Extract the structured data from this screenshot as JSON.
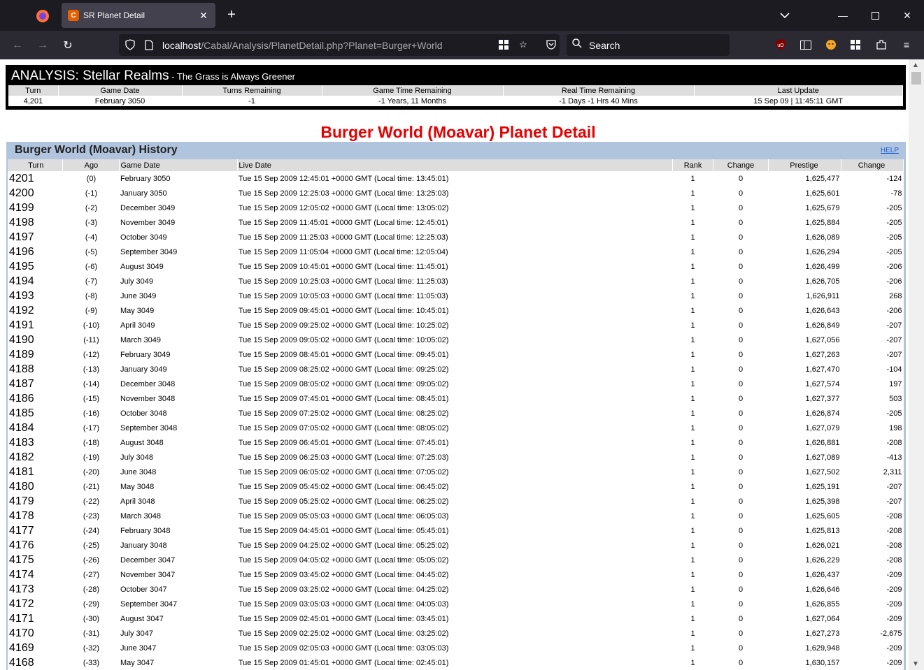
{
  "browser": {
    "tab_title": "SR Planet Detail",
    "url_host": "localhost",
    "url_path": "/Cabal/Analysis/PlanetDetail.php?Planet=Burger+World",
    "search_placeholder": "Search"
  },
  "analysis": {
    "title": "ANALYSIS: Stellar Realms",
    "subtitle": " - The Grass is Always Greener",
    "headers": [
      "Turn",
      "Game Date",
      "Turns Remaining",
      "Game Time Remaining",
      "Real Time Remaining",
      "Last Update"
    ],
    "values": [
      "4,201",
      "February 3050",
      "-1",
      "-1 Years, 11 Months",
      "-1 Days -1 Hrs 40 Mins",
      "15 Sep 09 | 11:45:11 GMT"
    ]
  },
  "page_heading": "Burger World (Moavar) Planet Detail",
  "history": {
    "title": "Burger World (Moavar) History",
    "help_label": "HELP",
    "columns": [
      "Turn",
      "Ago",
      "Game Date",
      "Live Date",
      "Rank",
      "Change",
      "Prestige",
      "Change"
    ],
    "rows": [
      [
        "4201",
        "(0)",
        "February 3050",
        "Tue 15 Sep 2009 12:45:01 +0000 GMT (Local time: 13:45:01)",
        "1",
        "0",
        "1,625,477",
        "-124"
      ],
      [
        "4200",
        "(-1)",
        "January 3050",
        "Tue 15 Sep 2009 12:25:03 +0000 GMT (Local time: 13:25:03)",
        "1",
        "0",
        "1,625,601",
        "-78"
      ],
      [
        "4199",
        "(-2)",
        "December 3049",
        "Tue 15 Sep 2009 12:05:02 +0000 GMT (Local time: 13:05:02)",
        "1",
        "0",
        "1,625,679",
        "-205"
      ],
      [
        "4198",
        "(-3)",
        "November 3049",
        "Tue 15 Sep 2009 11:45:01 +0000 GMT (Local time: 12:45:01)",
        "1",
        "0",
        "1,625,884",
        "-205"
      ],
      [
        "4197",
        "(-4)",
        "October 3049",
        "Tue 15 Sep 2009 11:25:03 +0000 GMT (Local time: 12:25:03)",
        "1",
        "0",
        "1,626,089",
        "-205"
      ],
      [
        "4196",
        "(-5)",
        "September 3049",
        "Tue 15 Sep 2009 11:05:04 +0000 GMT (Local time: 12:05:04)",
        "1",
        "0",
        "1,626,294",
        "-205"
      ],
      [
        "4195",
        "(-6)",
        "August 3049",
        "Tue 15 Sep 2009 10:45:01 +0000 GMT (Local time: 11:45:01)",
        "1",
        "0",
        "1,626,499",
        "-206"
      ],
      [
        "4194",
        "(-7)",
        "July 3049",
        "Tue 15 Sep 2009 10:25:03 +0000 GMT (Local time: 11:25:03)",
        "1",
        "0",
        "1,626,705",
        "-206"
      ],
      [
        "4193",
        "(-8)",
        "June 3049",
        "Tue 15 Sep 2009 10:05:03 +0000 GMT (Local time: 11:05:03)",
        "1",
        "0",
        "1,626,911",
        "268"
      ],
      [
        "4192",
        "(-9)",
        "May 3049",
        "Tue 15 Sep 2009 09:45:01 +0000 GMT (Local time: 10:45:01)",
        "1",
        "0",
        "1,626,643",
        "-206"
      ],
      [
        "4191",
        "(-10)",
        "April 3049",
        "Tue 15 Sep 2009 09:25:02 +0000 GMT (Local time: 10:25:02)",
        "1",
        "0",
        "1,626,849",
        "-207"
      ],
      [
        "4190",
        "(-11)",
        "March 3049",
        "Tue 15 Sep 2009 09:05:02 +0000 GMT (Local time: 10:05:02)",
        "1",
        "0",
        "1,627,056",
        "-207"
      ],
      [
        "4189",
        "(-12)",
        "February 3049",
        "Tue 15 Sep 2009 08:45:01 +0000 GMT (Local time: 09:45:01)",
        "1",
        "0",
        "1,627,263",
        "-207"
      ],
      [
        "4188",
        "(-13)",
        "January 3049",
        "Tue 15 Sep 2009 08:25:02 +0000 GMT (Local time: 09:25:02)",
        "1",
        "0",
        "1,627,470",
        "-104"
      ],
      [
        "4187",
        "(-14)",
        "December 3048",
        "Tue 15 Sep 2009 08:05:02 +0000 GMT (Local time: 09:05:02)",
        "1",
        "0",
        "1,627,574",
        "197"
      ],
      [
        "4186",
        "(-15)",
        "November 3048",
        "Tue 15 Sep 2009 07:45:01 +0000 GMT (Local time: 08:45:01)",
        "1",
        "0",
        "1,627,377",
        "503"
      ],
      [
        "4185",
        "(-16)",
        "October 3048",
        "Tue 15 Sep 2009 07:25:02 +0000 GMT (Local time: 08:25:02)",
        "1",
        "0",
        "1,626,874",
        "-205"
      ],
      [
        "4184",
        "(-17)",
        "September 3048",
        "Tue 15 Sep 2009 07:05:02 +0000 GMT (Local time: 08:05:02)",
        "1",
        "0",
        "1,627,079",
        "198"
      ],
      [
        "4183",
        "(-18)",
        "August 3048",
        "Tue 15 Sep 2009 06:45:01 +0000 GMT (Local time: 07:45:01)",
        "1",
        "0",
        "1,626,881",
        "-208"
      ],
      [
        "4182",
        "(-19)",
        "July 3048",
        "Tue 15 Sep 2009 06:25:03 +0000 GMT (Local time: 07:25:03)",
        "1",
        "0",
        "1,627,089",
        "-413"
      ],
      [
        "4181",
        "(-20)",
        "June 3048",
        "Tue 15 Sep 2009 06:05:02 +0000 GMT (Local time: 07:05:02)",
        "1",
        "0",
        "1,627,502",
        "2,311"
      ],
      [
        "4180",
        "(-21)",
        "May 3048",
        "Tue 15 Sep 2009 05:45:02 +0000 GMT (Local time: 06:45:02)",
        "1",
        "0",
        "1,625,191",
        "-207"
      ],
      [
        "4179",
        "(-22)",
        "April 3048",
        "Tue 15 Sep 2009 05:25:02 +0000 GMT (Local time: 06:25:02)",
        "1",
        "0",
        "1,625,398",
        "-207"
      ],
      [
        "4178",
        "(-23)",
        "March 3048",
        "Tue 15 Sep 2009 05:05:03 +0000 GMT (Local time: 06:05:03)",
        "1",
        "0",
        "1,625,605",
        "-208"
      ],
      [
        "4177",
        "(-24)",
        "February 3048",
        "Tue 15 Sep 2009 04:45:01 +0000 GMT (Local time: 05:45:01)",
        "1",
        "0",
        "1,625,813",
        "-208"
      ],
      [
        "4176",
        "(-25)",
        "January 3048",
        "Tue 15 Sep 2009 04:25:02 +0000 GMT (Local time: 05:25:02)",
        "1",
        "0",
        "1,626,021",
        "-208"
      ],
      [
        "4175",
        "(-26)",
        "December 3047",
        "Tue 15 Sep 2009 04:05:02 +0000 GMT (Local time: 05:05:02)",
        "1",
        "0",
        "1,626,229",
        "-208"
      ],
      [
        "4174",
        "(-27)",
        "November 3047",
        "Tue 15 Sep 2009 03:45:02 +0000 GMT (Local time: 04:45:02)",
        "1",
        "0",
        "1,626,437",
        "-209"
      ],
      [
        "4173",
        "(-28)",
        "October 3047",
        "Tue 15 Sep 2009 03:25:02 +0000 GMT (Local time: 04:25:02)",
        "1",
        "0",
        "1,626,646",
        "-209"
      ],
      [
        "4172",
        "(-29)",
        "September 3047",
        "Tue 15 Sep 2009 03:05:03 +0000 GMT (Local time: 04:05:03)",
        "1",
        "0",
        "1,626,855",
        "-209"
      ],
      [
        "4171",
        "(-30)",
        "August 3047",
        "Tue 15 Sep 2009 02:45:01 +0000 GMT (Local time: 03:45:01)",
        "1",
        "0",
        "1,627,064",
        "-209"
      ],
      [
        "4170",
        "(-31)",
        "July 3047",
        "Tue 15 Sep 2009 02:25:02 +0000 GMT (Local time: 03:25:02)",
        "1",
        "0",
        "1,627,273",
        "-2,675"
      ],
      [
        "4169",
        "(-32)",
        "June 3047",
        "Tue 15 Sep 2009 02:05:03 +0000 GMT (Local time: 03:05:03)",
        "1",
        "0",
        "1,629,948",
        "-209"
      ],
      [
        "4168",
        "(-33)",
        "May 3047",
        "Tue 15 Sep 2009 01:45:01 +0000 GMT (Local time: 02:45:01)",
        "1",
        "0",
        "1,630,157",
        "-209"
      ]
    ]
  }
}
